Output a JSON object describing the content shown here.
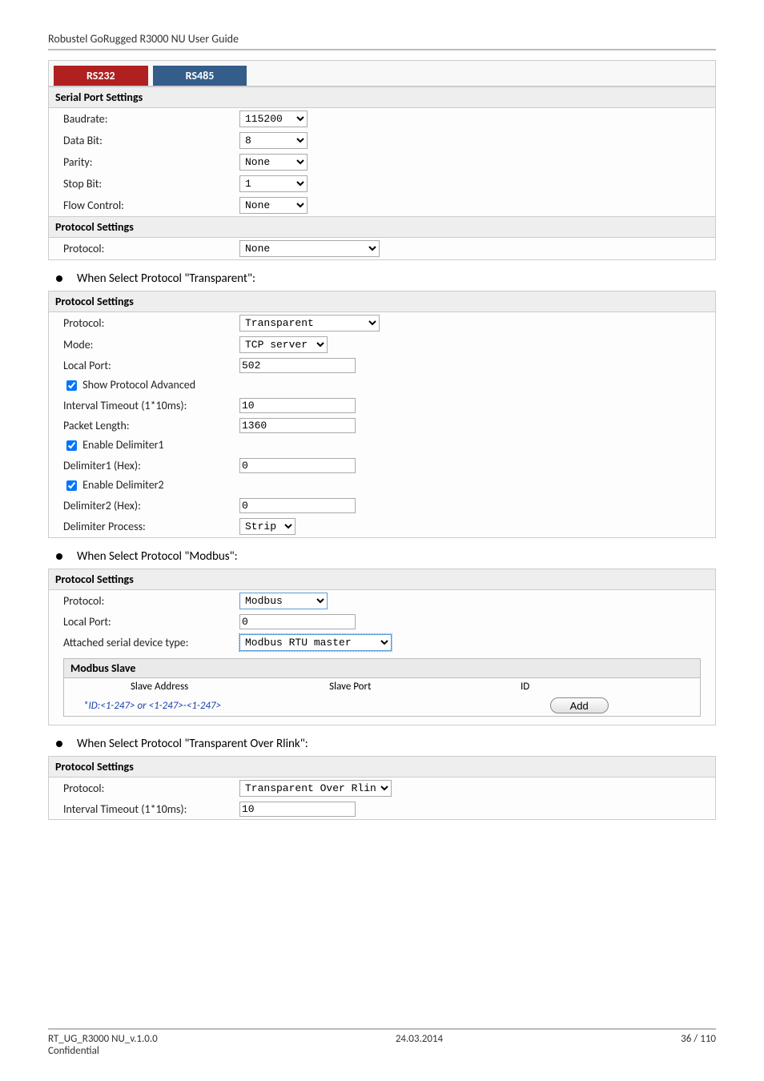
{
  "header_title": "Robustel GoRugged R3000 NU User Guide",
  "tabs": {
    "rs232": "RS232",
    "rs485": "RS485"
  },
  "serial_port": {
    "header": "Serial Port Settings",
    "baudrate_label": "Baudrate:",
    "baudrate_value": "115200",
    "databit_label": "Data Bit:",
    "databit_value": "8",
    "parity_label": "Parity:",
    "parity_value": "None",
    "stopbit_label": "Stop Bit:",
    "stopbit_value": "1",
    "flow_label": "Flow Control:",
    "flow_value": "None"
  },
  "protocol_none": {
    "header": "Protocol Settings",
    "protocol_label": "Protocol:",
    "protocol_value": "None"
  },
  "bullets": {
    "transparent": "When Select Protocol \"Transparent\":",
    "modbus": "When Select Protocol \"Modbus\":",
    "rlink": "When Select Protocol \"Transparent Over Rlink\":"
  },
  "transparent": {
    "header": "Protocol Settings",
    "protocol_label": "Protocol:",
    "protocol_value": "Transparent",
    "mode_label": "Mode:",
    "mode_value": "TCP server",
    "localport_label": "Local Port:",
    "localport_value": "502",
    "showadv_label": "Show Protocol Advanced",
    "interval_label": "Interval Timeout (1*10ms):",
    "interval_value": "10",
    "packetlen_label": "Packet Length:",
    "packetlen_value": "1360",
    "delim1_enable_label": "Enable Delimiter1",
    "delim1_label": "Delimiter1 (Hex):",
    "delim1_value": "0",
    "delim2_enable_label": "Enable Delimiter2",
    "delim2_label": "Delimiter2 (Hex):",
    "delim2_value": "0",
    "delimproc_label": "Delimiter Process:",
    "delimproc_value": "Strip"
  },
  "modbus": {
    "header": "Protocol Settings",
    "protocol_label": "Protocol:",
    "protocol_value": "Modbus",
    "localport_label": "Local Port:",
    "localport_value": "0",
    "attached_label": "Attached serial device type:",
    "attached_value": "Modbus RTU master",
    "slave_header": "Modbus Slave",
    "col_addr": "Slave Address",
    "col_port": "Slave Port",
    "col_id": "ID",
    "hint": "*ID:<1-247> or <1-247>-<1-247>",
    "add_btn": "Add"
  },
  "rlink": {
    "header": "Protocol Settings",
    "protocol_label": "Protocol:",
    "protocol_value": "Transparent Over Rlink",
    "interval_label": "Interval Timeout (1*10ms):",
    "interval_value": "10"
  },
  "footer": {
    "left_line1": "RT_UG_R3000 NU_v.1.0.0",
    "left_line2": "Confidential",
    "center": "24.03.2014",
    "right": "36 / 110"
  }
}
